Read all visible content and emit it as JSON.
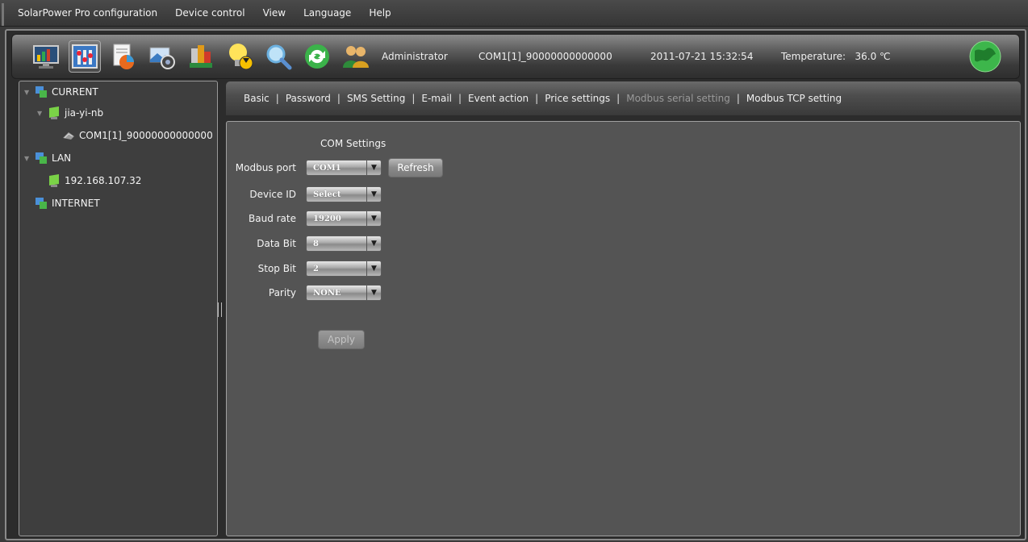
{
  "menu": [
    "SolarPower Pro configuration",
    "Device control",
    "View",
    "Language",
    "Help"
  ],
  "toolbar": {
    "icons": [
      "monitor-icon",
      "settings-icon",
      "report-icon",
      "camera-icon",
      "data-icon",
      "alarm-bulb-icon",
      "search-icon",
      "refresh-icon",
      "users-icon"
    ],
    "user": "Administrator",
    "device": "COM1[1]_90000000000000",
    "datetime": "2011-07-21 15:32:54",
    "temperature_label": "Temperature:",
    "temperature_value": "36.0 ℃"
  },
  "tree": {
    "current": "CURRENT",
    "host": "jia-yi-nb",
    "device": "COM1[1]_90000000000000",
    "lan": "LAN",
    "lan_ip": "192.168.107.32",
    "internet": "INTERNET"
  },
  "tabs": [
    {
      "label": "Basic",
      "disabled": false
    },
    {
      "label": "Password",
      "disabled": false
    },
    {
      "label": "SMS Setting",
      "disabled": false
    },
    {
      "label": "E-mail",
      "disabled": false
    },
    {
      "label": "Event action",
      "disabled": false
    },
    {
      "label": "Price settings",
      "disabled": false
    },
    {
      "label": "Modbus serial setting",
      "disabled": true
    },
    {
      "label": "Modbus TCP setting",
      "disabled": false
    }
  ],
  "form": {
    "title": "COM Settings",
    "modbus_port": {
      "label": "Modbus port",
      "value": "COM1"
    },
    "refresh": "Refresh",
    "device_id": {
      "label": "Device ID",
      "value": "Select"
    },
    "baud_rate": {
      "label": "Baud rate",
      "value": "19200"
    },
    "data_bit": {
      "label": "Data Bit",
      "value": "8"
    },
    "stop_bit": {
      "label": "Stop Bit",
      "value": "2"
    },
    "parity": {
      "label": "Parity",
      "value": "NONE"
    },
    "apply": "Apply"
  }
}
